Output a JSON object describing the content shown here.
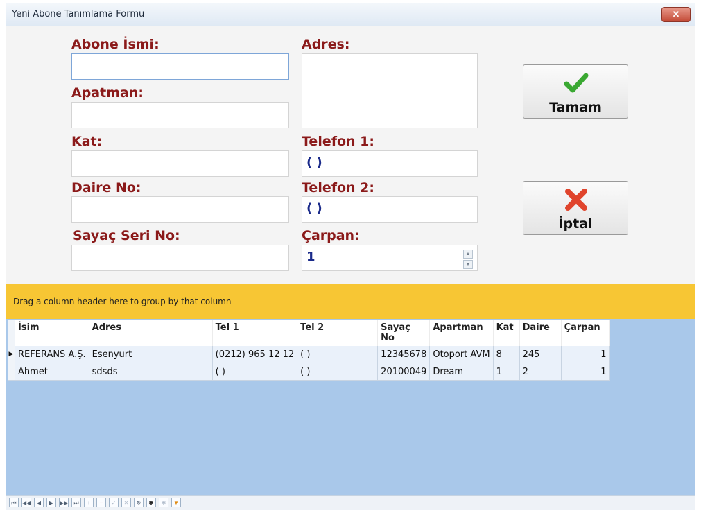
{
  "window": {
    "title": "Yeni Abone Tanımlama Formu",
    "close": "✕"
  },
  "form": {
    "abone_ismi": {
      "label": "Abone İsmi:",
      "value": ""
    },
    "apartman": {
      "label": "Apatman:",
      "value": ""
    },
    "kat": {
      "label": "Kat:",
      "value": ""
    },
    "daire_no": {
      "label": "Daire No:",
      "value": ""
    },
    "sayac_seri_no": {
      "label": "Sayaç Seri No:",
      "value": ""
    },
    "adres": {
      "label": "Adres:",
      "value": ""
    },
    "telefon1": {
      "label": "Telefon 1:",
      "value": "(    )"
    },
    "telefon2": {
      "label": "Telefon 2:",
      "value": "(    )"
    },
    "carpan": {
      "label": "Çarpan:",
      "value": "1"
    }
  },
  "buttons": {
    "ok": {
      "label": "Tamam",
      "icon": "check-icon",
      "color": "#3aa832"
    },
    "cancel": {
      "label": "İptal",
      "icon": "x-icon",
      "color": "#e0442c"
    }
  },
  "grid": {
    "group_hint": "Drag a column header here to group by that column",
    "columns": [
      "İsim",
      "Adres",
      "Tel 1",
      "Tel 2",
      "Sayaç No",
      "Apartman",
      "Kat",
      "Daire",
      "Çarpan"
    ],
    "rows": [
      [
        "REFERANS A.Ş.",
        "Esenyurt",
        "(0212) 965 12 12",
        "(   )",
        "12345678",
        "Otoport AVM",
        "8",
        "245",
        "1"
      ],
      [
        "Ahmet",
        "sdsds",
        "(   )",
        "(   )",
        "20100049",
        "Dream",
        "1",
        "2",
        "1"
      ]
    ],
    "navigator": [
      "first",
      "prev-page",
      "prev",
      "next",
      "next-page",
      "last",
      "insert",
      "delete",
      "post",
      "cancel",
      "refresh",
      "bookmark",
      "goto-bookmark",
      "filter"
    ]
  },
  "colors": {
    "label": "#8b1a1a",
    "group_bar": "#f7c634",
    "grid_bg": "#a9c8ea"
  }
}
